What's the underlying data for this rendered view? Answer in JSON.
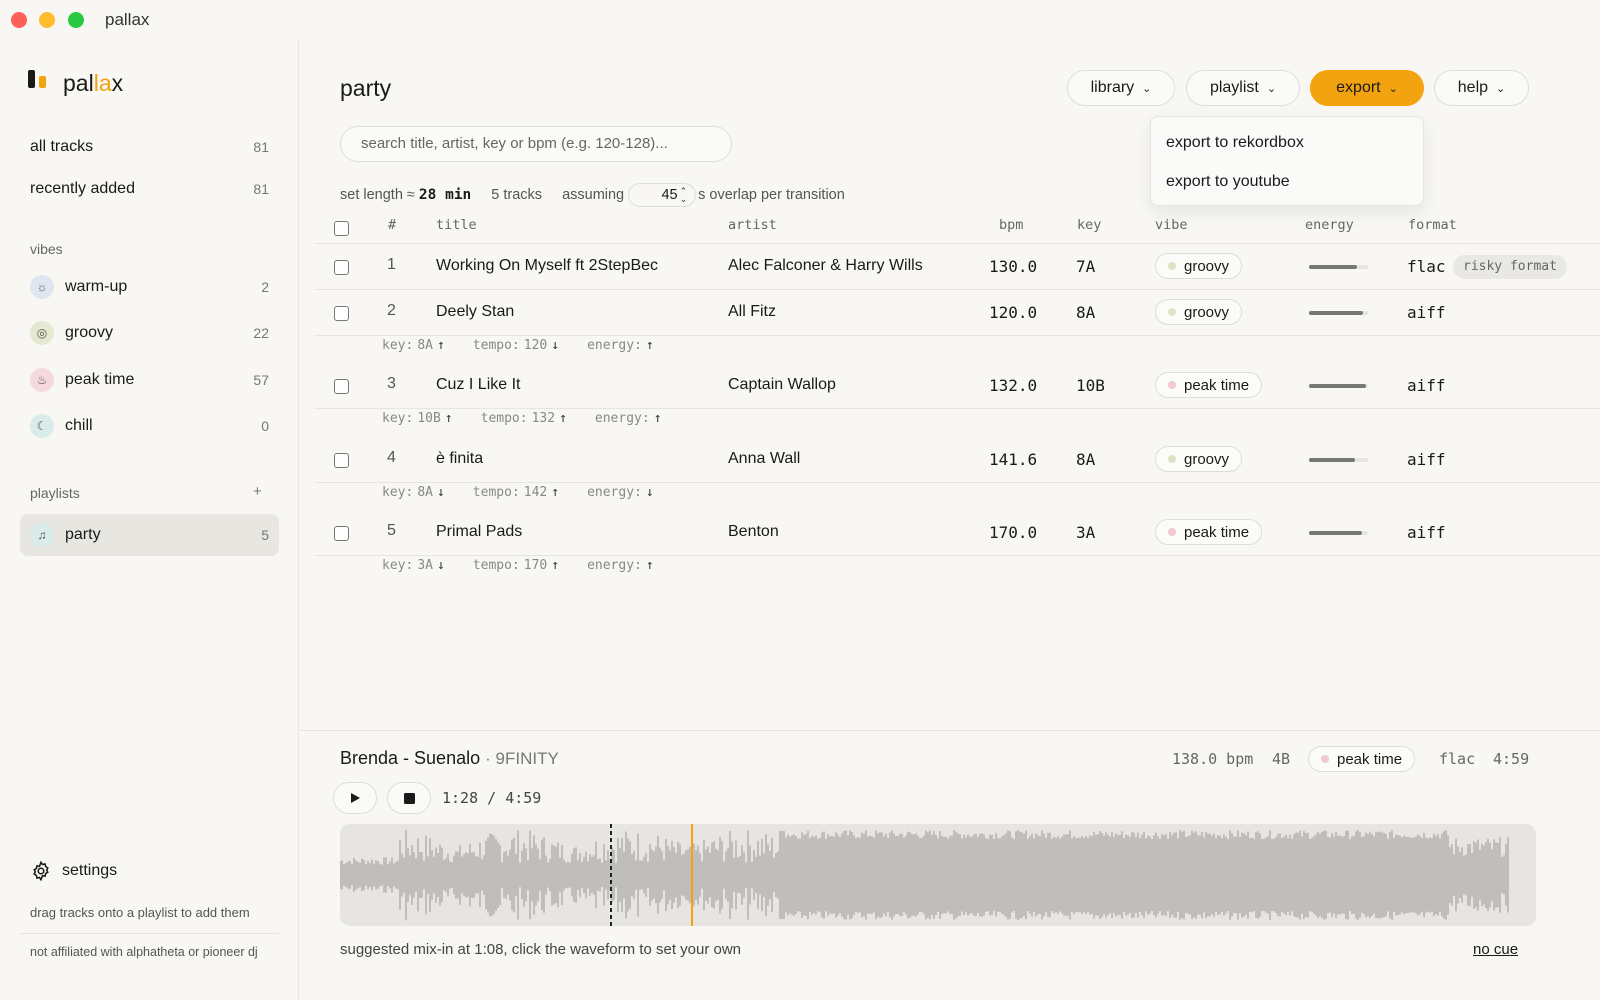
{
  "window": {
    "title": "pallax"
  },
  "sidebar": {
    "logo": {
      "text_a": "pal",
      "text_b": "la",
      "text_c": "x"
    },
    "library_items": [
      {
        "label": "all tracks",
        "count": "81"
      },
      {
        "label": "recently added",
        "count": "81"
      }
    ],
    "vibes_header": "vibes",
    "vibes": [
      {
        "label": "warm-up",
        "count": "2",
        "icon": "sun-icon",
        "color": "#dfe6f2"
      },
      {
        "label": "groovy",
        "count": "22",
        "icon": "groove-icon",
        "color": "#e6e9d2"
      },
      {
        "label": "peak time",
        "count": "57",
        "icon": "flame-icon",
        "color": "#f4dade"
      },
      {
        "label": "chill",
        "count": "0",
        "icon": "moon-icon",
        "color": "#d9ece9"
      }
    ],
    "playlists_header": "playlists",
    "add_playlist": "+",
    "playlists": [
      {
        "label": "party",
        "count": "5",
        "icon": "bell-icon"
      }
    ],
    "settings_label": "settings",
    "drag_hint": "drag tracks onto a playlist to add them",
    "disclaimer": "not affiliated with alphatheta or pioneer dj"
  },
  "main": {
    "title": "party",
    "toolbar": {
      "library": "library",
      "playlist": "playlist",
      "export": "export",
      "help": "help"
    },
    "export_menu": [
      "export to rekordbox",
      "export to youtube"
    ],
    "search_placeholder": "search title, artist, key or bpm (e.g. 120-128)...",
    "summary": {
      "set_length_label": "set length ≈",
      "set_length_value": "28 min",
      "tracks": "5 tracks",
      "assuming": "assuming",
      "overlap": "45",
      "overlap_suffix": "s overlap per transition"
    },
    "columns": {
      "num": "#",
      "title": "title",
      "artist": "artist",
      "bpm": "bpm",
      "key": "key",
      "vibe": "vibe",
      "energy": "energy",
      "format": "format"
    },
    "tracks": [
      {
        "num": "1",
        "title": "Working On Myself ft 2StepBec",
        "artist": "Alec Falconer & Harry Wills",
        "bpm": "130.0",
        "key": "7A",
        "vibe": "groovy",
        "energy": 0.82,
        "format": "flac",
        "badge": "risky format"
      },
      {
        "num": "2",
        "title": "Deely Stan",
        "artist": "All Fitz",
        "bpm": "120.0",
        "key": "8A",
        "vibe": "groovy",
        "energy": 0.92,
        "format": "aiff",
        "badge": ""
      },
      {
        "num": "3",
        "title": "Cuz I Like It",
        "artist": "Captain Wallop",
        "bpm": "132.0",
        "key": "10B",
        "vibe": "peak time",
        "energy": 0.97,
        "format": "aiff",
        "badge": ""
      },
      {
        "num": "4",
        "title": "è finita",
        "artist": "Anna Wall",
        "bpm": "141.6",
        "key": "8A",
        "vibe": "groovy",
        "energy": 0.78,
        "format": "aiff",
        "badge": ""
      },
      {
        "num": "5",
        "title": "Primal Pads",
        "artist": "Benton",
        "bpm": "170.0",
        "key": "3A",
        "vibe": "peak time",
        "energy": 0.9,
        "format": "aiff",
        "badge": ""
      }
    ],
    "transitions": [
      {
        "key_label": "key:",
        "key": "8A",
        "key_dir": "↑",
        "tempo_label": "tempo:",
        "tempo": "120",
        "tempo_dir": "↓",
        "energy_label": "energy:",
        "energy_dir": "↑"
      },
      {
        "key_label": "key:",
        "key": "10B",
        "key_dir": "↑",
        "tempo_label": "tempo:",
        "tempo": "132",
        "tempo_dir": "↑",
        "energy_label": "energy:",
        "energy_dir": "↑"
      },
      {
        "key_label": "key:",
        "key": "8A",
        "key_dir": "↓",
        "tempo_label": "tempo:",
        "tempo": "142",
        "tempo_dir": "↑",
        "energy_label": "energy:",
        "energy_dir": "↓"
      },
      {
        "key_label": "key:",
        "key": "3A",
        "key_dir": "↓",
        "tempo_label": "tempo:",
        "tempo": "170",
        "tempo_dir": "↑",
        "energy_label": "energy:",
        "energy_dir": "↑"
      }
    ]
  },
  "vibe_colors": {
    "groovy": "#dfe3c6",
    "peak time": "#f1c9cf"
  },
  "player": {
    "title": "Brenda - Suenalo",
    "artist": "· 9FINITY",
    "bpm": "138.0 bpm",
    "key": "4B",
    "vibe": "peak time",
    "format": "flac",
    "duration": "4:59",
    "current": "1:28",
    "separator": "/",
    "total": "4:59",
    "playhead_fraction": 0.294,
    "mixin_fraction": 0.227,
    "footer": "suggested mix-in at 1:08, click the waveform to set your own",
    "no_cue": "no cue"
  },
  "colors": {
    "accent": "#f2a30f"
  }
}
